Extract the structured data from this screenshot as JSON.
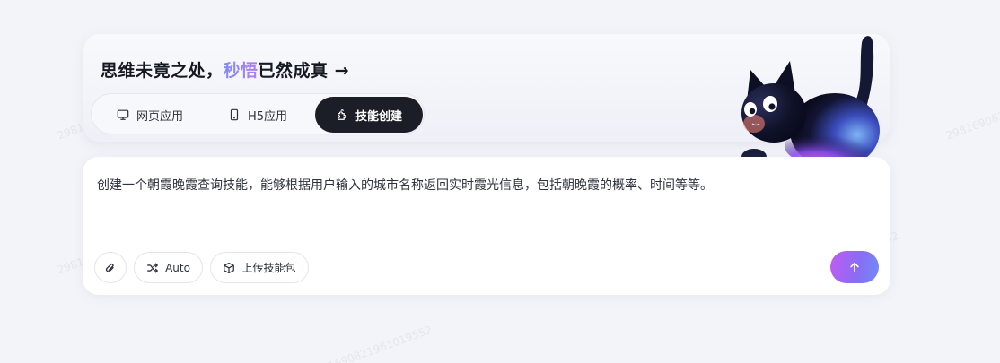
{
  "headline": {
    "prefix": "思维未竟之处，",
    "accent": "秒悟",
    "suffix": "已然成真 →",
    "accent_gradient": [
      "#7e8cf2",
      "#b17cf0"
    ]
  },
  "tabs": [
    {
      "label": "网页应用",
      "icon": "monitor-icon",
      "active": false
    },
    {
      "label": "H5应用",
      "icon": "mobile-icon",
      "active": false
    },
    {
      "label": "技能创建",
      "icon": "puzzle-icon",
      "active": true
    }
  ],
  "prompt": {
    "text": "创建一个朝霞晚霞查询技能，能够根据用户输入的城市名称返回实时霞光信息，包括朝晚霞的概率、时间等等。"
  },
  "toolbar": {
    "attach_icon": "paperclip-icon",
    "auto_label": "Auto",
    "auto_icon": "shuffle-icon",
    "upload_label": "上传技能包",
    "upload_icon": "package-icon",
    "send_icon": "arrow-up-icon"
  },
  "watermark": {
    "text": "2981690821961019552"
  },
  "colors": {
    "active_tab_bg": "#1b1e27",
    "send_gradient": [
      "#c05cf0",
      "#8a6cf5",
      "#6f8cf6"
    ],
    "page_bg": "#f3f4f9"
  },
  "mascot": {
    "icon": "black-cat-mascot"
  }
}
